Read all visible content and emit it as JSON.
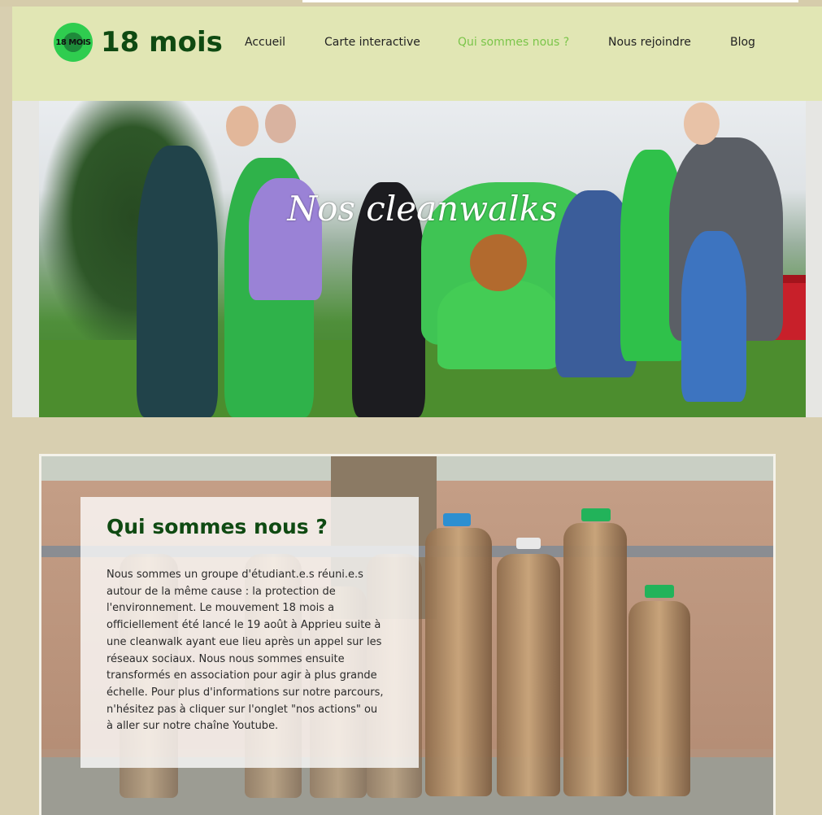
{
  "header": {
    "logo_badge_text": "18 MOIS",
    "logo_text": "18 mois",
    "nav": [
      {
        "label": "Accueil",
        "active": false
      },
      {
        "label": "Carte interactive",
        "active": false
      },
      {
        "label": "Qui sommes nous ?",
        "active": true
      },
      {
        "label": "Nous rejoindre",
        "active": false
      },
      {
        "label": "Blog",
        "active": false
      }
    ],
    "accent_color": "#7bc54a",
    "brand_color": "#0f4a12"
  },
  "hero": {
    "title": "Nos cleanwalks"
  },
  "about": {
    "title": "Qui sommes nous ?",
    "body": "Nous sommes un groupe d'étudiant.e.s réuni.e.s autour de la même cause : la protection de l'environnement. Le mouvement 18 mois a officiellement été lancé le 19 août à Apprieu suite à une cleanwalk ayant eue lieu après un appel sur les réseaux sociaux. Nous nous sommes ensuite transformés en association pour agir à plus grande échelle. Pour plus d'informations sur notre parcours, n'hésitez pas à cliquer sur l'onglet \"nos actions\" ou à aller sur notre chaîne Youtube."
  }
}
